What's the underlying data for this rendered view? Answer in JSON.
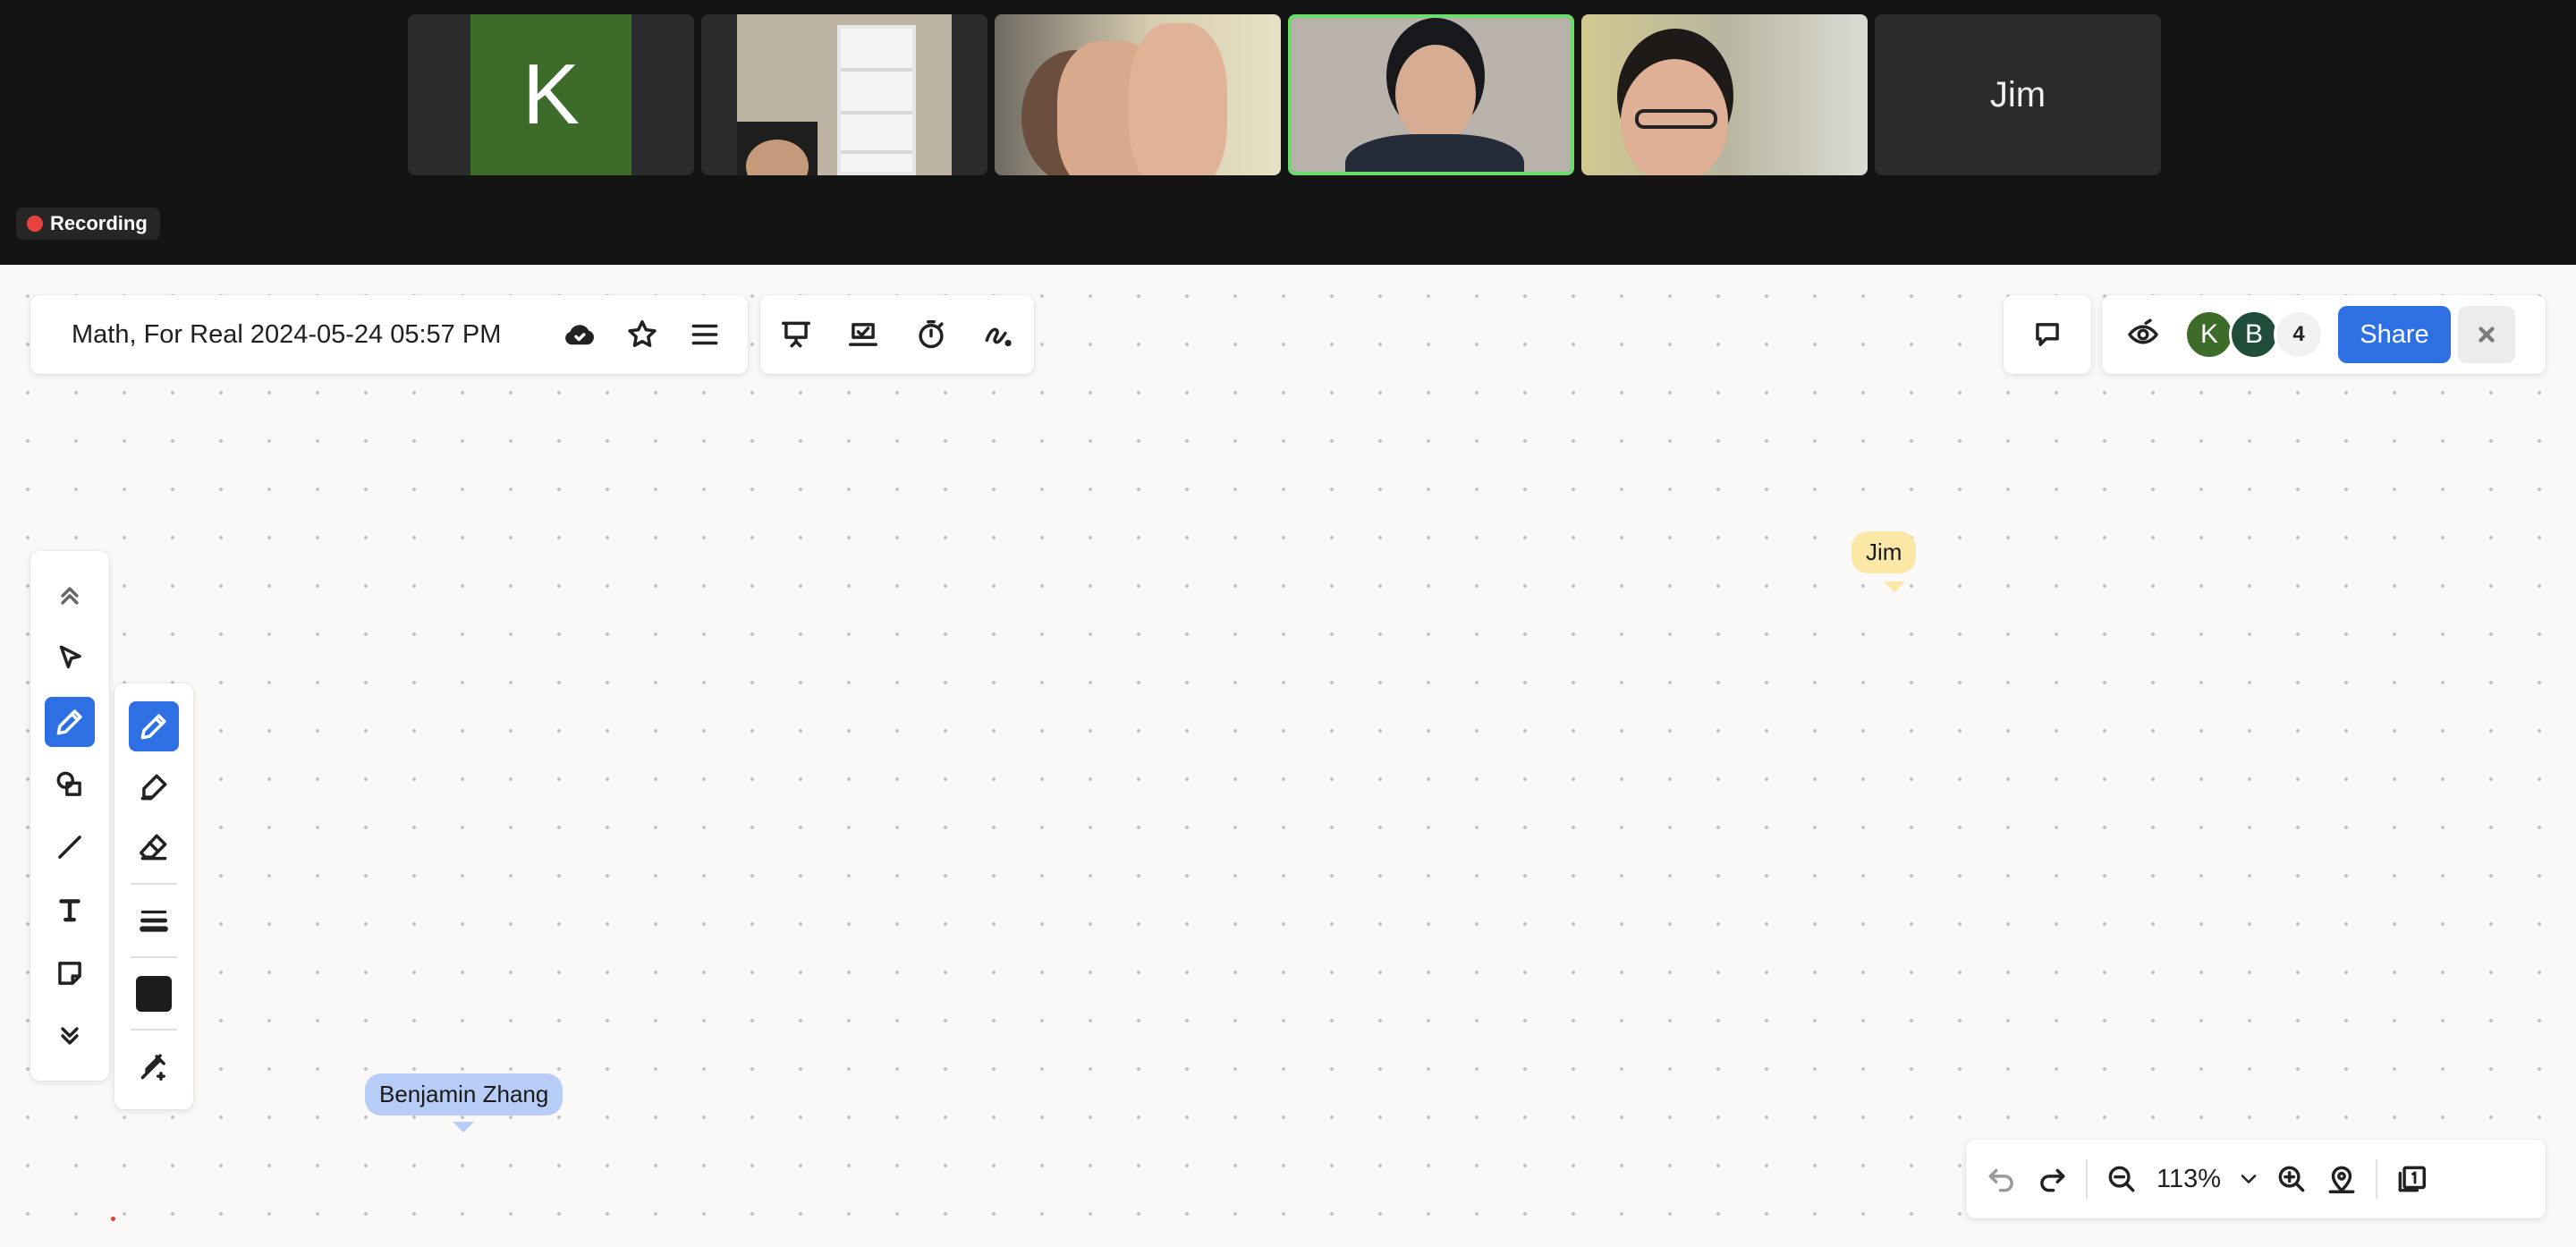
{
  "video": {
    "participants": [
      {
        "type": "initial",
        "initial": "K"
      },
      {
        "type": "video",
        "scene": "room-with-bookshelf"
      },
      {
        "type": "video",
        "scene": "hand-in-front-of-camera"
      },
      {
        "type": "video",
        "scene": "person-facing-camera",
        "active_speaker": true
      },
      {
        "type": "video",
        "scene": "person-with-glasses"
      },
      {
        "type": "name",
        "name": "Jim"
      }
    ],
    "recording_label": "Recording",
    "recording_color": "#e8423f"
  },
  "header": {
    "board_title": "Math, For Real 2024-05-24 05:57 PM",
    "icons": [
      "cloud-check-icon",
      "star-icon",
      "menu-icon"
    ],
    "tools": [
      "present-icon",
      "vote-icon",
      "timer-icon",
      "laser-pointer-icon"
    ]
  },
  "collab": {
    "avatars": [
      {
        "initial": "K",
        "color": "#3c6b2a"
      },
      {
        "initial": "B",
        "color": "#1f4d3a"
      }
    ],
    "count": "4",
    "share_label": "Share",
    "accent": "#2f6fe4"
  },
  "toolbar": {
    "tools": [
      "collapse-up",
      "select",
      "pen",
      "shapes",
      "line",
      "text",
      "sticky-note",
      "expand-down"
    ],
    "selected": "pen",
    "pen_options": [
      "pen",
      "highlighter",
      "eraser",
      "stroke-width",
      "color",
      "eyedropper"
    ],
    "pen_color": "#1c1c1c"
  },
  "cursors": [
    {
      "name": "Jim",
      "color": "#fbe7a6"
    },
    {
      "name": "Benjamin Zhang",
      "color": "#b7ccf7"
    }
  ],
  "footer": {
    "zoom_level": "113%"
  }
}
